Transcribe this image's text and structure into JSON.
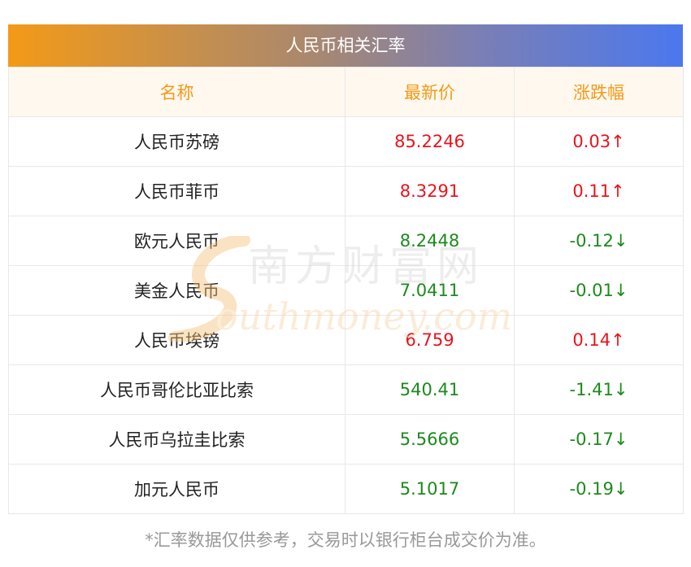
{
  "title": "人民币相关汇率",
  "columns": [
    "名称",
    "最新价",
    "涨跌幅"
  ],
  "rows": [
    {
      "name": "人民币苏磅",
      "price": "85.2246",
      "change": "0.03↑",
      "dir": "up"
    },
    {
      "name": "人民币菲币",
      "price": "8.3291",
      "change": "0.11↑",
      "dir": "up"
    },
    {
      "name": "欧元人民币",
      "price": "8.2448",
      "change": "-0.12↓",
      "dir": "down"
    },
    {
      "name": "美金人民币",
      "price": "7.0411",
      "change": "-0.01↓",
      "dir": "down"
    },
    {
      "name": "人民币埃镑",
      "price": "6.759",
      "change": "0.14↑",
      "dir": "up"
    },
    {
      "name": "人民币哥伦比亚比索",
      "price": "540.41",
      "change": "-1.41↓",
      "dir": "down"
    },
    {
      "name": "人民币乌拉圭比索",
      "price": "5.5666",
      "change": "-0.17↓",
      "dir": "down"
    },
    {
      "name": "加元人民币",
      "price": "5.1017",
      "change": "-0.19↓",
      "dir": "down"
    }
  ],
  "footnote": "*汇率数据仅供参考，交易时以银行柜台成交价为准。",
  "watermark": {
    "cn": "南方财富网",
    "en": "outhmoney.com"
  },
  "colors": {
    "up": "#e8141e",
    "down": "#1c8a1c",
    "header_text": "#f39a17"
  }
}
